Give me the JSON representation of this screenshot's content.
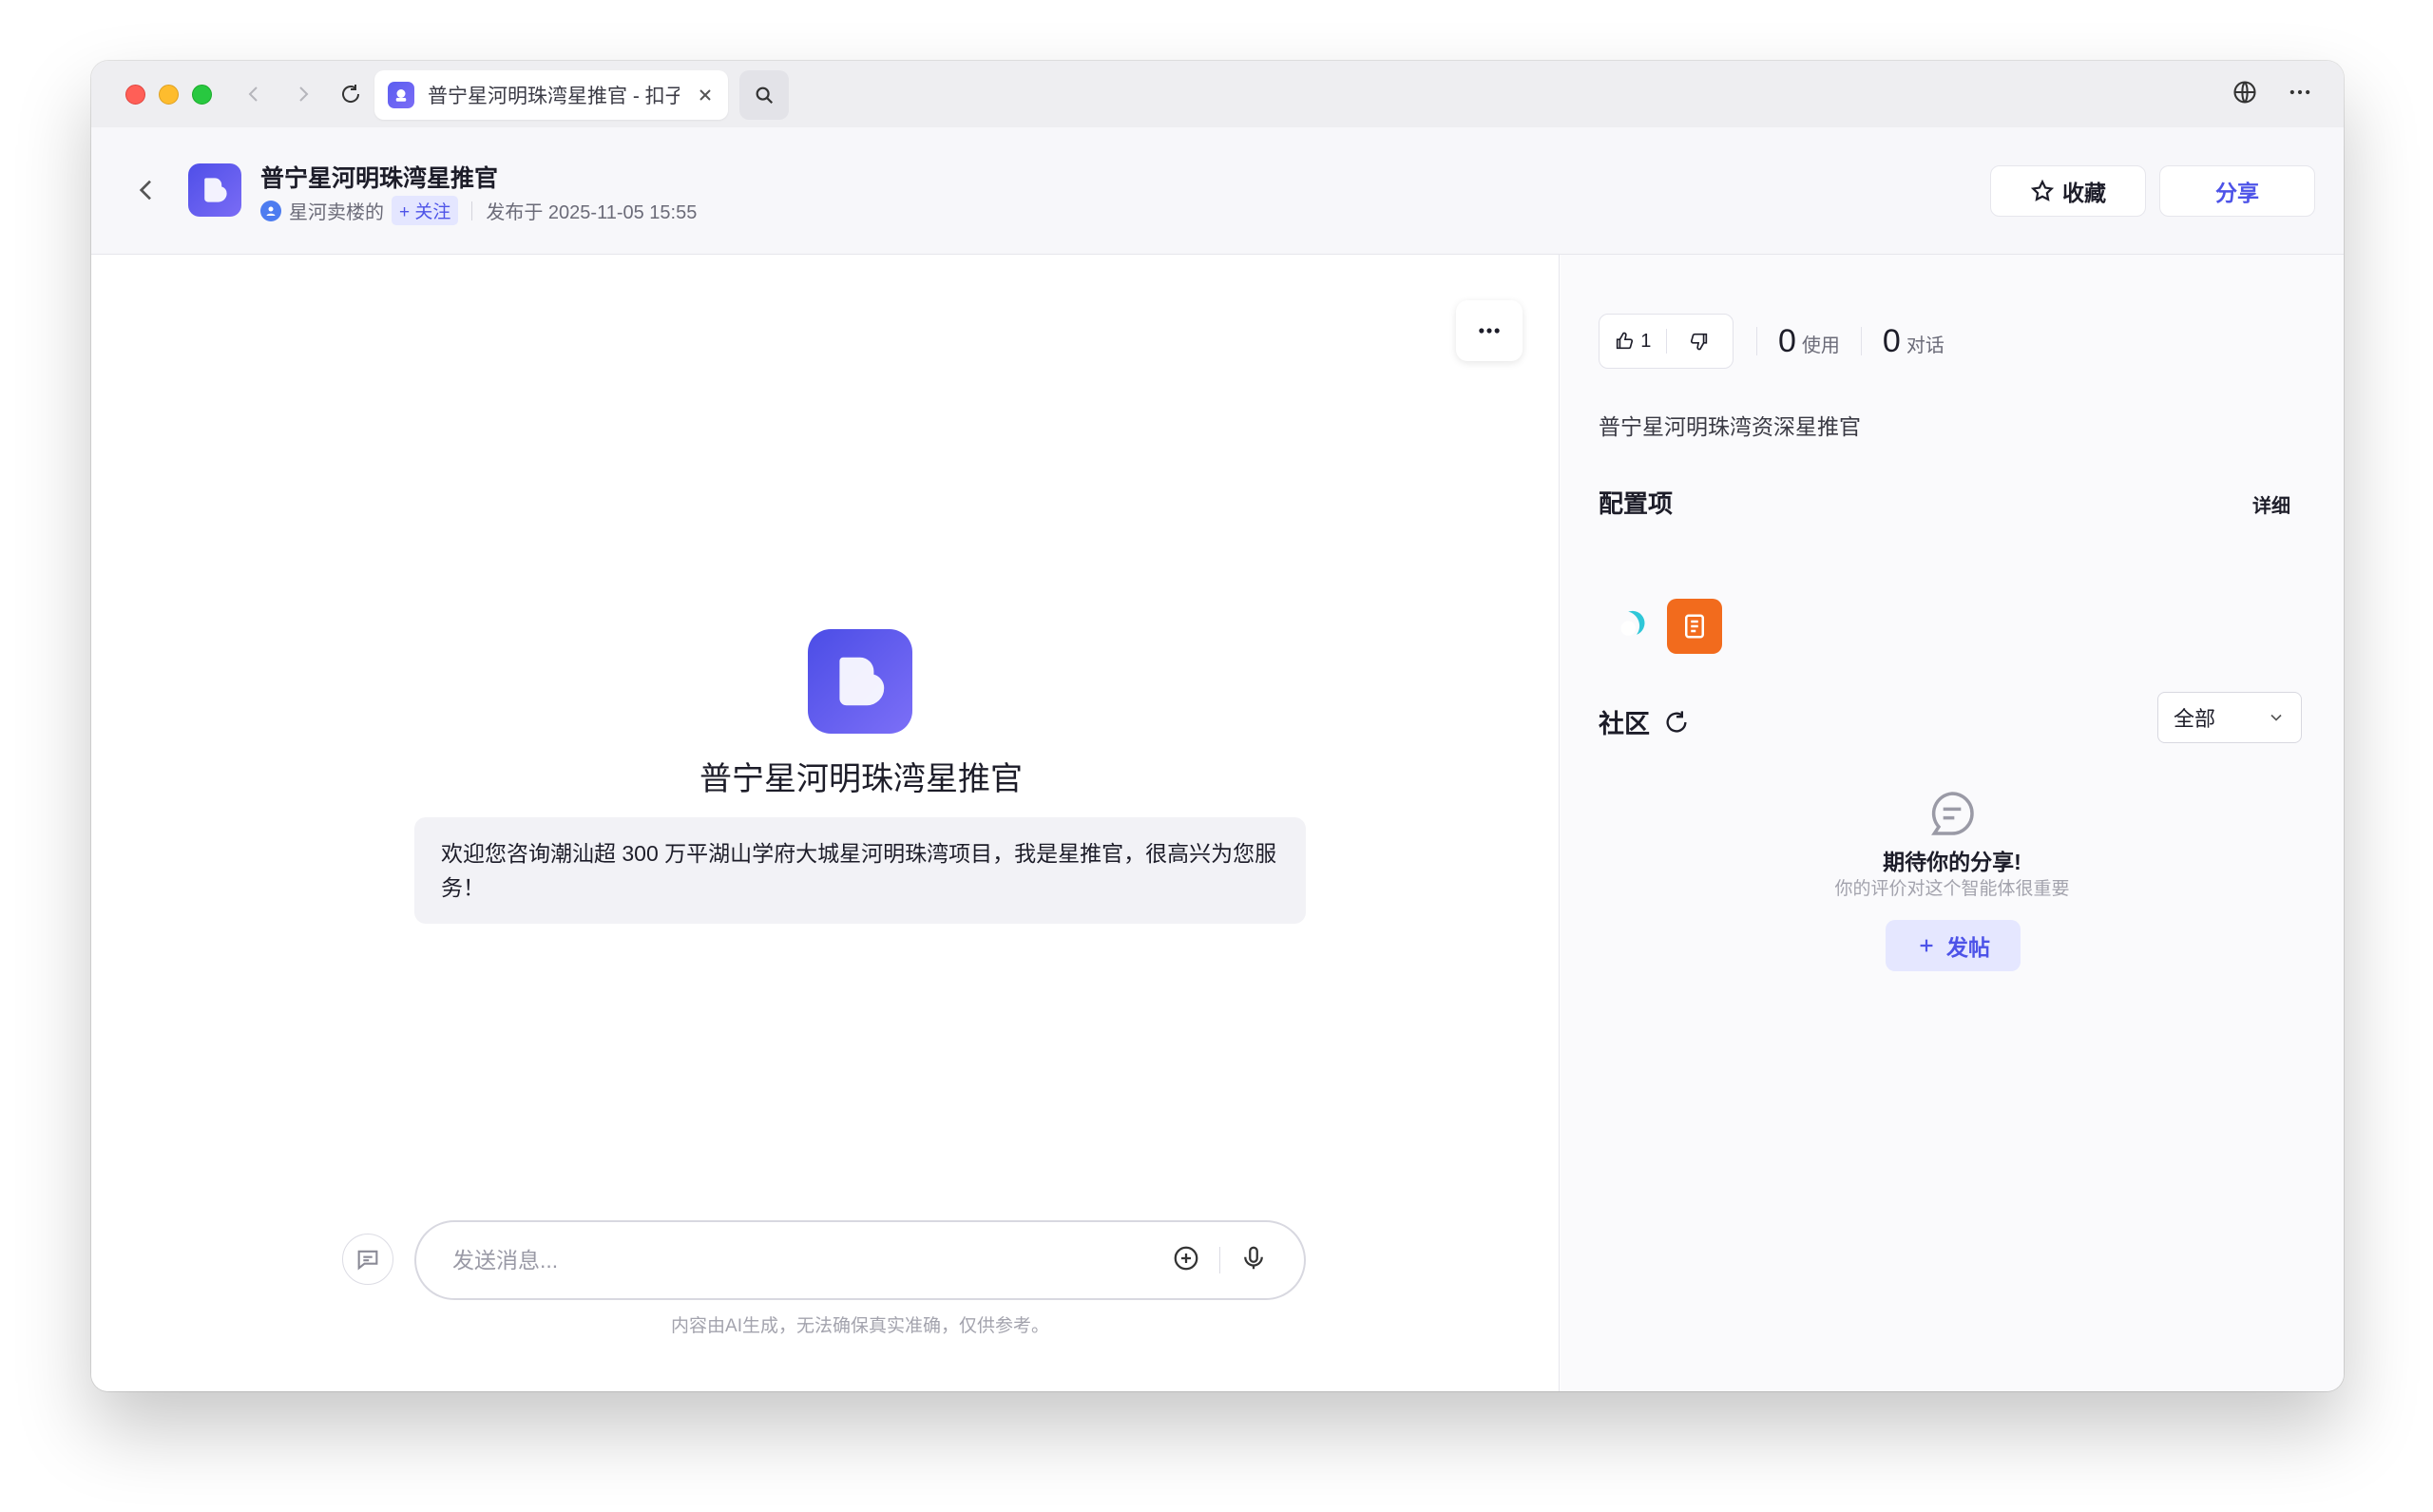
{
  "browser": {
    "tab_title": "普宁星河明珠湾星推官 - 扣子"
  },
  "header": {
    "bot_name": "普宁星河明珠湾星推官",
    "author": "星河卖楼的",
    "follow_label": "+ 关注",
    "published": "发布于 2025-11-05 15:55",
    "favorite_label": "收藏",
    "share_label": "分享"
  },
  "chat": {
    "bot_name": "普宁星河明珠湾星推官",
    "welcome": "欢迎您咨询潮汕超 300 万平湖山学府大城星河明珠湾项目，我是星推官，很高兴为您服务！",
    "input_placeholder": "发送消息...",
    "disclaimer": "内容由AI生成，无法确保真实准确，仅供参考。"
  },
  "panel": {
    "likes": "1",
    "uses_count": "0",
    "uses_label": "使用",
    "dialogs_count": "0",
    "dialogs_label": "对话",
    "description": "普宁星河明珠湾资深星推官",
    "config_title": "配置项",
    "config_detail": "详细",
    "community_title": "社区",
    "filter_value": "全部",
    "empty_title": "期待你的分享!",
    "empty_sub": "你的评价对这个智能体很重要",
    "post_label": "发帖"
  },
  "colors": {
    "accent": "#4d53e8",
    "plugin_orange": "#f26b1d"
  }
}
